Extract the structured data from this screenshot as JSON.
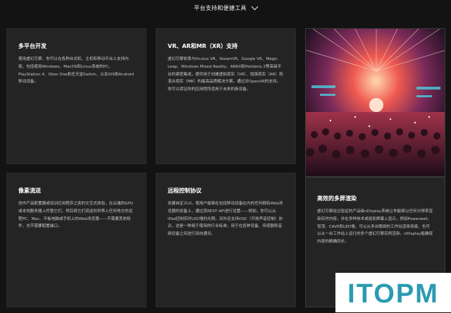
{
  "header": {
    "title": "平台支持和便捷工具"
  },
  "cards": {
    "multi_platform": {
      "title": "多平台开发",
      "text": "使用虚幻引擎，你可以在各种台式机、主机和移动平台上支持内容，包括使用Windows、MacOS和Linux系统的PC，PlayStation 4、Xbox One和任天堂Switch，以及iOS和Android移动设备。"
    },
    "vr": {
      "title": "VR、AR和MR（XR）支持",
      "text": "虚幻引擎依靠与Oculus VR、SteamVR、Google VR、Magic Leap、Windows Mixed Reality、ARKit和Hololens 2等高级平台的紧密集成，提供用于创建虚拟现实（VR）、增强现实（AR）和混合现实（MR）的最高品质解决方案。通过对OpenXR的支持，你可以保证你的应用程序适用于未来的新设备。"
    },
    "pixel": {
      "title": "像素流送",
      "text": "创作产品配置器或培训应用程序之类的交互式体验，在云端的GPU或本地服务器上托管它们，然后将它们流送到世界上任何地方的远程PC、Mac、平板电脑或手机上的Web浏览器——不需要其他软件，也不需要配置端口。"
    },
    "remote": {
      "title": "远程控制协议",
      "text": "创建自定义UI，使用户能够在包括移动设备在内的任何拥有Web浏览器的设备上，通过其REST API进行设置——例如，你可以从iPad控制实时LED墙的光照。另外还支持OSC（开放声音控制）协议，这是一种易于使用的行业标准，用于在各种设备、传感器和音频设备之间进行双向通讯。"
    },
    "multi_screen": {
      "title": "高效的多屏渲染",
      "text": "虚幻引擎经过验证的产品级nDisplay系统让你能够以任何分辨率渲染实时内容，并在多种技术或投影屏幕上显示，例如Powerwall、穹顶、CAVE和LED墙。可以从多台联网的工作站渲染场景，也可以从一台工作站上运行的多个虚幻引擎实例渲染，nDisplay能确保内容的精确同步。"
    }
  },
  "logo": {
    "text": "ITOPM"
  },
  "colors": {
    "background": "#131313",
    "card": "#242424",
    "logo_teal": "#2a9bb0"
  }
}
